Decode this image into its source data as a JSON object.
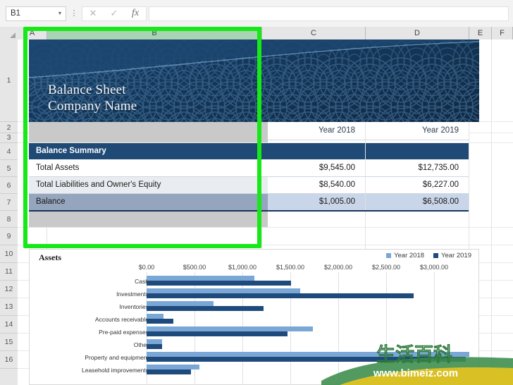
{
  "app": {
    "namebox_value": "B1",
    "formula_value": "",
    "buttons": {
      "cancel": "✕",
      "confirm": "✓",
      "function": "fx",
      "menu_dots": "⋮",
      "namebox_caret": "▼"
    }
  },
  "grid": {
    "columns": [
      "A",
      "B",
      "C",
      "D",
      "E",
      "F"
    ],
    "selected_column": "B",
    "rows": [
      "1",
      "2",
      "3",
      "4",
      "5",
      "6",
      "7",
      "8",
      "9",
      "10",
      "11",
      "12",
      "13",
      "14",
      "15",
      "16"
    ]
  },
  "banner": {
    "title": "Balance Sheet",
    "subtitle": "Company Name"
  },
  "sheet": {
    "year_headers": [
      "Year 2018",
      "Year 2019"
    ],
    "summary_header": "Balance Summary",
    "rows": [
      {
        "label": "Total Assets",
        "y2018": "$9,545.00",
        "y2019": "$12,735.00"
      },
      {
        "label": "Total Liabilities and Owner's Equity",
        "y2018": "$8,540.00",
        "y2019": "$6,227.00"
      },
      {
        "label": "Balance",
        "y2018": "$1,005.00",
        "y2019": "$6,508.00"
      }
    ]
  },
  "chart_data": {
    "type": "bar",
    "orientation": "horizontal",
    "title": "Assets",
    "xlabel": "",
    "ylabel": "",
    "xlim": [
      0,
      3000
    ],
    "xticks": [
      0,
      500,
      1000,
      1500,
      2000,
      2500,
      3000
    ],
    "xtick_labels": [
      "$0.00",
      "$500.00",
      "$1,000.00",
      "$1,500.00",
      "$2,000.00",
      "$2,500.00",
      "$3,000.00"
    ],
    "grid": true,
    "legend": [
      "Year 2018",
      "Year 2019"
    ],
    "legend_position": "top-right",
    "colors": {
      "Year 2018": "#7ba7d7",
      "Year 2019": "#1f4a7c"
    },
    "categories": [
      "Cash",
      "Investments",
      "Inventories",
      "Accounts receivable",
      "Pre-paid expenses",
      "Other",
      "Property and equipment",
      "Leasehold improvements"
    ],
    "series": [
      {
        "name": "Year 2018",
        "values": [
          1000,
          1430,
          625,
          155,
          1545,
          145,
          3000,
          490
        ]
      },
      {
        "name": "Year 2019",
        "values": [
          1345,
          2480,
          1090,
          250,
          1310,
          145,
          2970,
          415
        ]
      }
    ]
  },
  "watermark": {
    "text_cn": "生活百科",
    "url": "www.bimeiz.com"
  },
  "colors": {
    "selection_green": "#17e817",
    "banner_dark": "#12314f",
    "summary_blue": "#1f4a76",
    "balance_row": "#c9d5e8",
    "series_2018": "#7ba7d7",
    "series_2019": "#1f4a7c"
  }
}
